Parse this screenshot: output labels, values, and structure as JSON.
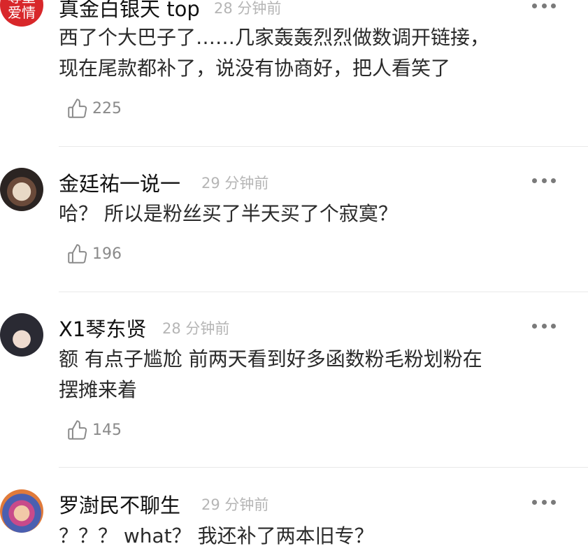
{
  "comments": [
    {
      "username": "真金白银天 top",
      "time": "28 分钟前",
      "text": "西了个大巴子了……几家轰轰烈烈做数调开链接，\n现在尾款都补了，说没有协商好，把人看笑了",
      "likes": "225",
      "avatar_text": [
        "尊重",
        "爱情"
      ],
      "avatar_color": "#d8272a"
    },
    {
      "username": "金廷祐一说一",
      "time": "29 分钟前",
      "text": "哈？ 所以是粉丝买了半天买了个寂寞？",
      "likes": "196"
    },
    {
      "username": "X1琴东贤",
      "time": "28 分钟前",
      "text": "额 有点子尴尬 前两天看到好多函数粉毛粉划粉在\n摆摊来着",
      "likes": "145"
    },
    {
      "username": "罗澍民不聊生",
      "time": "29 分钟前",
      "text": "？？？ what？ 我还补了两本旧专？"
    }
  ],
  "icons": {
    "like": "thumbs-up-icon",
    "more": "more-dots-icon"
  }
}
